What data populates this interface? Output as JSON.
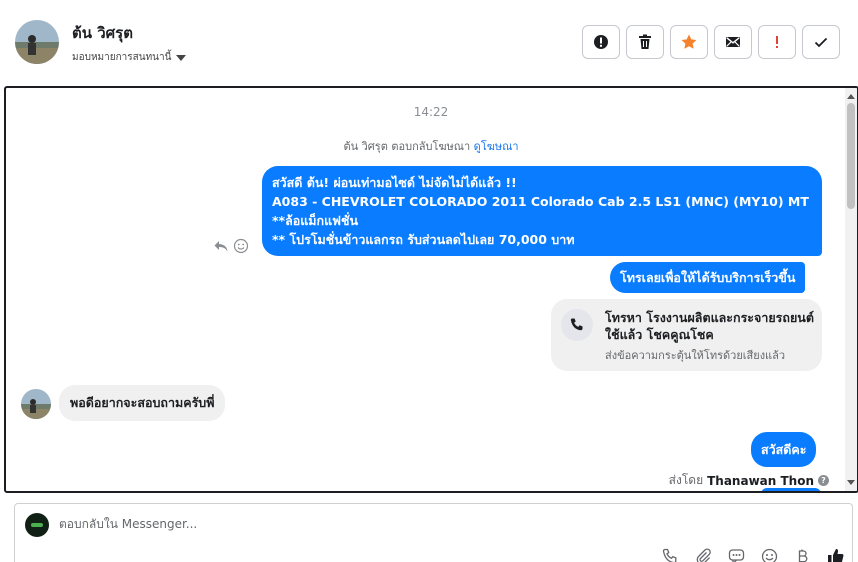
{
  "header": {
    "contact_name": "ต้น วิศรุต",
    "assign_label": "มอบหมายการสนทนานี้",
    "actions": [
      {
        "name": "spam-button",
        "icon": "alert-circle-icon"
      },
      {
        "name": "delete-button",
        "icon": "trash-icon"
      },
      {
        "name": "star-button",
        "icon": "star-icon",
        "color": "#f5822a"
      },
      {
        "name": "mark-unread-button",
        "icon": "envelope-icon"
      },
      {
        "name": "follow-up-button",
        "icon": "exclamation-icon",
        "color": "#e0433b"
      },
      {
        "name": "done-button",
        "icon": "checkmark-icon"
      }
    ]
  },
  "conversation": {
    "timestamp": "14:22",
    "reply_note": "ต้น วิศรุต ตอบกลับโฆษณา",
    "reply_note_link": "ดูโฆษณา",
    "messages": {
      "promo_line1": "สวัสดี ต้น! ผ่อนเท่ามอไซด์ ไม่จัดไม่ได้แล้ว !!",
      "promo_line2": "A083 - CHEVROLET COLORADO 2011 Colorado Cab 2.5 LS1 (MNC) (MY10) MT **ล้อแม็กแฟชั่น",
      "promo_line3": "** โปรโมชั่นข้าวแลกรถ รับส่วนลดไปเลย 70,000 บาท",
      "call_prompt": "โทรเลยเพื่อให้ได้รับบริการเร็วขึ้น",
      "call_card_title": "โทรหา โรงงานผลิตและกระจายรถยนต์ใช้แล้ว โชคคูณโชค",
      "call_card_subtitle": "ส่งข้อความกระตุ้นให้โทรด้วยเสียงแล้ว",
      "customer_message": "พอดีอยากจะสอบถามครับพี่",
      "agent_reply": "สวัสดีคะ"
    },
    "sent_by_label": "ส่งโดย",
    "sent_by_name": "Thanawan Thon"
  },
  "composer": {
    "placeholder": "ตอบกลับใน Messenger...",
    "tools": [
      "phone-icon",
      "paperclip-icon",
      "chat-bubble-icon",
      "emoji-icon",
      "baht-icon",
      "thumbs-up-icon"
    ]
  },
  "colors": {
    "accent_blue": "#0a7cff",
    "bubble_grey": "#f0f0f0",
    "star_orange": "#f5822a",
    "alert_red": "#e0433b"
  }
}
